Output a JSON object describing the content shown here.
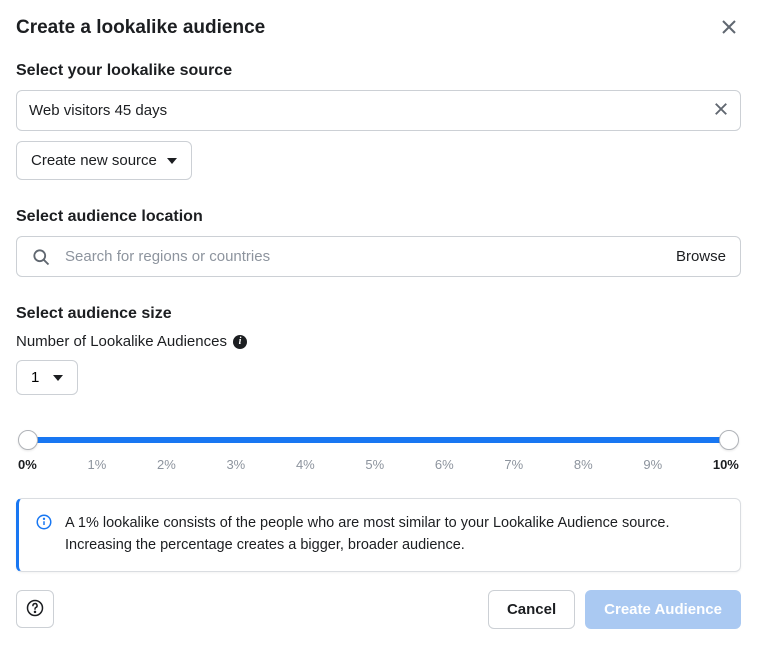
{
  "modal": {
    "title": "Create a lookalike audience"
  },
  "source": {
    "label": "Select your lookalike source",
    "value": "Web visitors 45 days",
    "create_button": "Create new source"
  },
  "location": {
    "label": "Select audience location",
    "placeholder": "Search for regions or countries",
    "browse": "Browse"
  },
  "size": {
    "label": "Select audience size",
    "count_label": "Number of Lookalike Audiences",
    "count_value": "1",
    "ticks": [
      "0%",
      "1%",
      "2%",
      "3%",
      "4%",
      "5%",
      "6%",
      "7%",
      "8%",
      "9%",
      "10%"
    ],
    "range_min": 0,
    "range_max": 10
  },
  "banner": {
    "text": "A 1% lookalike consists of the people who are most similar to your Lookalike Audience source. Increasing the percentage creates a bigger, broader audience."
  },
  "footer": {
    "cancel": "Cancel",
    "create": "Create Audience"
  }
}
